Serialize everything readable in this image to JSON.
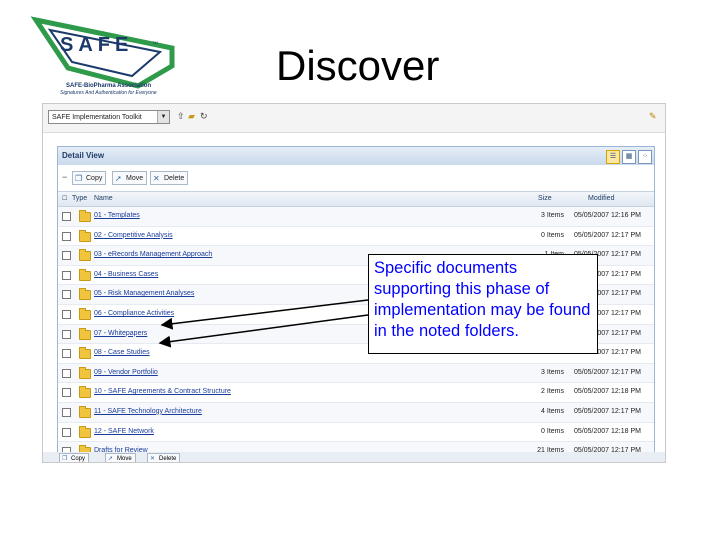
{
  "slide": {
    "title": "Discover"
  },
  "logo": {
    "wordmark": "SAFE",
    "tm": "TM",
    "tagline1": "SAFE-BioPharma Association",
    "tagline2": "Signatures And Authentication for Everyone"
  },
  "toolbar": {
    "library_select": "SAFE Implementation Toolkit"
  },
  "panel": {
    "title": "Detail View",
    "actions": {
      "copy": "Copy",
      "move": "Move",
      "delete": "Delete"
    },
    "columns": {
      "type": "Type",
      "name": "Name",
      "size": "Size",
      "modified": "Modified"
    },
    "rows": [
      {
        "name": "01 - Templates",
        "size": "3 Items",
        "modified": "05/05/2007 12:16 PM"
      },
      {
        "name": "02 - Competitive Analysis",
        "size": "0 Items",
        "modified": "05/05/2007 12:17 PM"
      },
      {
        "name": "03 - eRecords Management Approach",
        "size": "1 Item",
        "modified": "05/05/2007 12:17 PM"
      },
      {
        "name": "04 - Business Cases",
        "size": "",
        "modified": "05/05/2007 12:17 PM"
      },
      {
        "name": "05 - Risk Management Analyses",
        "size": "",
        "modified": "05/05/2007 12:17 PM"
      },
      {
        "name": "06 - Compliance Activities",
        "size": "",
        "modified": "05/05/2007 12:17 PM"
      },
      {
        "name": "07 - Whitepapers",
        "size": "",
        "modified": "05/05/2007 12:17 PM"
      },
      {
        "name": "08 - Case Studies",
        "size": "",
        "modified": "05/05/2007 12:17 PM"
      },
      {
        "name": "09 - Vendor Portfolio",
        "size": "3 Items",
        "modified": "05/05/2007 12:17 PM"
      },
      {
        "name": "10 - SAFE Agreements & Contract Structure",
        "size": "2 Items",
        "modified": "05/05/2007 12:18 PM"
      },
      {
        "name": "11 - SAFE Technology Architecture",
        "size": "4 Items",
        "modified": "05/05/2007 12:17 PM"
      },
      {
        "name": "12 - SAFE Network",
        "size": "0 Items",
        "modified": "05/05/2007 12:18 PM"
      },
      {
        "name": "Drafts for Review",
        "size": "21 Items",
        "modified": "05/05/2007 12:17 PM"
      }
    ]
  },
  "callout": {
    "text": "Specific documents supporting this phase of implementation may be found in the noted folders."
  },
  "colors": {
    "accent_blue": "#0000ff",
    "logo_blue": "#1b3a6b",
    "logo_green": "#2e9a4a",
    "folder_yellow": "#f0c43c"
  }
}
